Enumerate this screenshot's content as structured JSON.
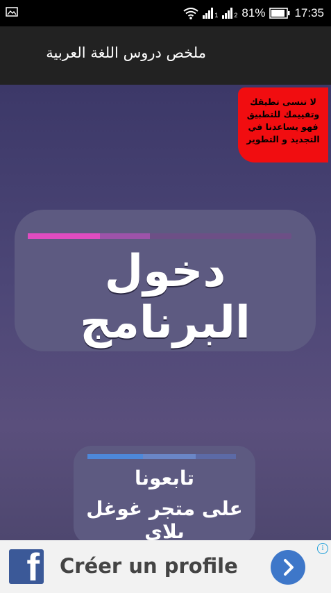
{
  "status_bar": {
    "battery_percent": "81%",
    "time": "17:35",
    "signal1_sub": "1",
    "signal2_sub": "2",
    "icons": [
      "gallery-icon",
      "wifi-icon",
      "signal-icon",
      "signal-icon",
      "battery-icon"
    ]
  },
  "app_bar": {
    "title": "ملخص دروس اللغة العربية"
  },
  "rating_banner": {
    "lines": [
      "لا تنسى  تطيقك",
      "وتقييمك للتطبيق",
      "فهو يساعدنا  في",
      "التجديد  و التطوير"
    ],
    "color": "#f10d10"
  },
  "enter_button": {
    "label": "دخول البرنامج",
    "accent": "#e04cc0"
  },
  "follow_box": {
    "line1": "تابعونا",
    "line2": "على متجر غوغل بلاي",
    "accent": "#4d88d9"
  },
  "ad_banner": {
    "text": "Créer un profile",
    "logo_letter": "f",
    "brand_color": "#3b5998",
    "icons": [
      "facebook-logo-icon",
      "chevron-right-icon",
      "info-icon"
    ]
  }
}
